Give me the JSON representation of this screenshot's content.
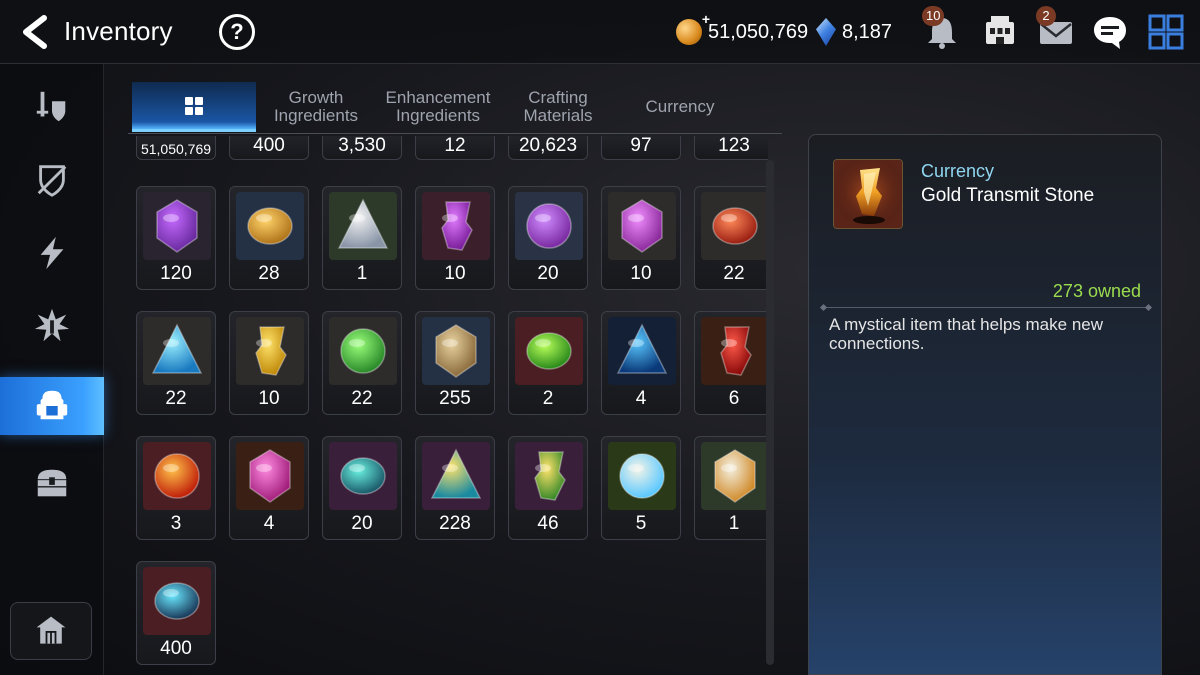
{
  "header": {
    "title": "Inventory",
    "help_label": "?",
    "gold": "51,050,769",
    "crystals": "8,187",
    "notification_count": "10",
    "mail_count": "2"
  },
  "tabs": [
    {
      "label": "",
      "icon": "grid-icon",
      "active": true
    },
    {
      "label": "Growth Ingredients"
    },
    {
      "label": "Enhancement Ingredients"
    },
    {
      "label": "Crafting Materials"
    },
    {
      "label": "Currency"
    }
  ],
  "sidebar": {
    "items": [
      {
        "name": "equipment",
        "icon": "sword-shield-icon"
      },
      {
        "name": "artifact",
        "icon": "broken-shield-icon"
      },
      {
        "name": "catalyst",
        "icon": "lightning-icon"
      },
      {
        "name": "hero-material",
        "icon": "burst-icon"
      },
      {
        "name": "bag",
        "icon": "backpack-icon",
        "active": true
      },
      {
        "name": "chest",
        "icon": "treasure-chest-icon"
      }
    ],
    "bottom": {
      "name": "storage",
      "icon": "house-icon"
    }
  },
  "grid": {
    "partial_row": [
      "51,050,769",
      "400",
      "3,530",
      "12",
      "20,623",
      "97",
      "123"
    ],
    "rows": [
      [
        {
          "count": "120",
          "icon": "purple-flower-icon",
          "bg": "#2a2430"
        },
        {
          "count": "28",
          "icon": "gold-flower-icon",
          "bg": "#243044"
        },
        {
          "count": "1",
          "icon": "silver-flower-icon",
          "bg": "#2d3a2a"
        },
        {
          "count": "10",
          "icon": "purple-pentagon-rune-icon",
          "bg": "#3b1f2a"
        },
        {
          "count": "20",
          "icon": "purple-triangle-rune-icon",
          "bg": "#2a3346"
        },
        {
          "count": "10",
          "icon": "purple-oval-rune-icon",
          "bg": "#2e2c2a"
        },
        {
          "count": "22",
          "icon": "red-oval-rune-icon",
          "bg": "#2e2c2a"
        }
      ],
      [
        {
          "count": "22",
          "icon": "ice-rune-icon",
          "bg": "#2e2c2a"
        },
        {
          "count": "10",
          "icon": "lightning-rune-icon",
          "bg": "#2e2c2a"
        },
        {
          "count": "22",
          "icon": "earth-rune-icon",
          "bg": "#2e2c2a"
        },
        {
          "count": "255",
          "icon": "root-herb-icon",
          "bg": "#243044"
        },
        {
          "count": "2",
          "icon": "green-orb-icon",
          "bg": "#4a1e22"
        },
        {
          "count": "4",
          "icon": "blue-disc-icon",
          "bg": "#132036"
        },
        {
          "count": "6",
          "icon": "red-hex-gem-icon",
          "bg": "#3a1f14"
        }
      ],
      [
        {
          "count": "3",
          "icon": "red-transmit-stone-icon",
          "bg": "#4a1e22"
        },
        {
          "count": "4",
          "icon": "pink-potion-icon",
          "bg": "#3a1f14"
        },
        {
          "count": "20",
          "icon": "teal-hex-stone-icon",
          "bg": "#3a1f3a"
        },
        {
          "count": "228",
          "icon": "teal-transmit-stone-icon",
          "bg": "#3a1f3a"
        },
        {
          "count": "46",
          "icon": "green-transmit-stone-icon",
          "bg": "#3a1f3a"
        },
        {
          "count": "5",
          "icon": "white-star-stone-icon",
          "bg": "#2a3a18"
        },
        {
          "count": "1",
          "icon": "white-transmit-stone-icon",
          "bg": "#2d3a2a"
        }
      ],
      [
        {
          "count": "400",
          "icon": "shard-cluster-icon",
          "bg": "#4a1e22"
        }
      ]
    ]
  },
  "detail": {
    "category": "Currency",
    "name": "Gold Transmit Stone",
    "owned": "273 owned",
    "description": "A mystical item that helps make new connections."
  },
  "colors": {
    "accent_blue": "#3aa0ff",
    "owned_green": "#9bdc4f",
    "category_cyan": "#8fd6f0"
  }
}
